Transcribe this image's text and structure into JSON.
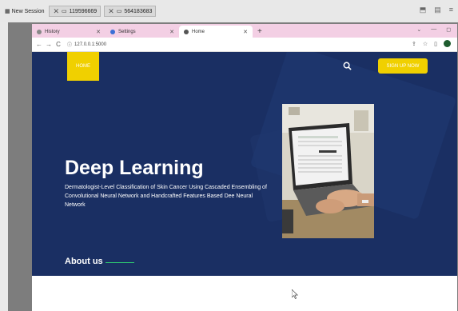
{
  "session": {
    "new_session_label": "New Session",
    "tabs": [
      {
        "label": "119596669"
      },
      {
        "label": "564183683"
      }
    ]
  },
  "browser": {
    "tabs": [
      {
        "label": "History",
        "active": false
      },
      {
        "label": "Settings",
        "active": false
      },
      {
        "label": "Home",
        "active": true
      }
    ],
    "url": "127.0.0.1:5000"
  },
  "site": {
    "nav": {
      "home_label": "HOME",
      "signup_label": "SIGN UP NOW"
    },
    "hero": {
      "title": "Deep Learning",
      "description": "Dermatologist-Level Classification of Skin Cancer Using Cascaded Ensembling of Convolutional Neural Network and Handcrafted Features Based Dee Neural Network"
    },
    "about_heading": "About us"
  },
  "colors": {
    "site_background": "#1a2f63",
    "accent_yellow": "#f0d000",
    "tabstrip_pink": "#f3cfe4",
    "about_underline": "#2ecc71"
  }
}
